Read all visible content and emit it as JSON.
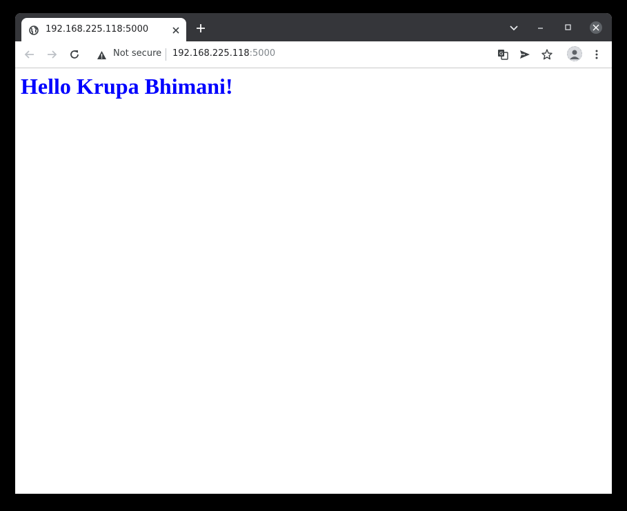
{
  "browser": {
    "tab": {
      "title": "192.168.225.118:5000",
      "favicon": "globe-icon"
    },
    "address_bar": {
      "security_label": "Not secure",
      "host": "192.168.225.118",
      "port": ":5000"
    },
    "toolbar_icons": [
      "back-icon",
      "forward-icon",
      "reload-icon",
      "translate-icon",
      "send-icon",
      "star-icon",
      "profile-icon",
      "menu-icon"
    ],
    "window_controls": [
      "tab-search-icon",
      "minimize-icon",
      "maximize-icon",
      "close-icon"
    ]
  },
  "page": {
    "heading": "Hello Krupa Bhimani!",
    "heading_color": "#0000ff"
  }
}
